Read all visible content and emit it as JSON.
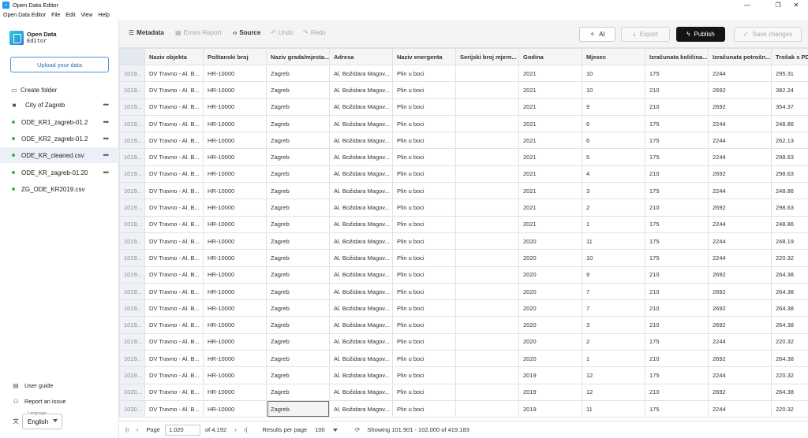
{
  "window": {
    "title": "Open Data Editor",
    "menu": [
      "Open Data Editor",
      "File",
      "Edit",
      "View",
      "Help"
    ]
  },
  "sidebar": {
    "logo_line1": "Open Data",
    "logo_line2": "Editor",
    "upload_label": "Upload your data",
    "create_folder_label": "Create folder",
    "folder_label": "City of Zagreb",
    "files": [
      {
        "label": "ODE_KR1_zagreb-01.2",
        "status_color": "#3bb54a"
      },
      {
        "label": "ODE_KR2_zagreb-01.2",
        "status_color": "#3bb54a"
      },
      {
        "label": "ODE_KR_cleaned.csv",
        "status_color": "#3bb54a"
      },
      {
        "label": "ODE_KR_zagreb-01.20",
        "status_color": "#3bb54a"
      },
      {
        "label": "ZG_ODE_KR2019.csv",
        "status_color": "#3bb54a"
      }
    ],
    "user_guide_label": "User guide",
    "report_issue_label": "Report an issue",
    "language_legend": "Language",
    "language_value": "English"
  },
  "toolbar": {
    "metadata_label": "Metadata",
    "errors_label": "Errors Report",
    "source_label": "Source",
    "undo_label": "Undo",
    "redo_label": "Redo",
    "ai_label": "AI",
    "export_label": "Export",
    "publish_label": "Publish",
    "save_label": "Save changes"
  },
  "grid": {
    "columns": [
      "",
      "Naziv objekta",
      "Poštanski broj",
      "Naziv grada/mjesta...",
      "Adresa",
      "Naziv energenta",
      "Serijski broj mjern...",
      "Godina",
      "Mjesec",
      "Izračunata količina...",
      "Izračunata potrošn...",
      "Trošak s PDV"
    ],
    "rows": [
      [
        "1019...",
        "DV Travno - Al. B...",
        "HR-10000",
        "Zagreb",
        "Al. Božidara Magov...",
        "Plin u boci",
        "",
        "2021",
        "10",
        "175",
        "2244",
        "295.31"
      ],
      [
        "1019...",
        "DV Travno - Al. B...",
        "HR-10000",
        "Zagreb",
        "Al. Božidara Magov...",
        "Plin u boci",
        "",
        "2021",
        "10",
        "210",
        "2692",
        "382.24"
      ],
      [
        "1019...",
        "DV Travno - Al. B...",
        "HR-10000",
        "Zagreb",
        "Al. Božidara Magov...",
        "Plin u boci",
        "",
        "2021",
        "9",
        "210",
        "2692",
        "354.37"
      ],
      [
        "1019...",
        "DV Travno - Al. B...",
        "HR-10000",
        "Zagreb",
        "Al. Božidara Magov...",
        "Plin u boci",
        "",
        "2021",
        "6",
        "175",
        "2244",
        "248.86"
      ],
      [
        "1019...",
        "DV Travno - Al. B...",
        "HR-10000",
        "Zagreb",
        "Al. Božidara Magov...",
        "Plin u boci",
        "",
        "2021",
        "6",
        "175",
        "2244",
        "262.13"
      ],
      [
        "1019...",
        "DV Travno - Al. B...",
        "HR-10000",
        "Zagreb",
        "Al. Božidara Magov...",
        "Plin u boci",
        "",
        "2021",
        "5",
        "175",
        "2244",
        "298.63"
      ],
      [
        "1019...",
        "DV Travno - Al. B...",
        "HR-10000",
        "Zagreb",
        "Al. Božidara Magov...",
        "Plin u boci",
        "",
        "2021",
        "4",
        "210",
        "2692",
        "298.63"
      ],
      [
        "1019...",
        "DV Travno - Al. B...",
        "HR-10000",
        "Zagreb",
        "Al. Božidara Magov...",
        "Plin u boci",
        "",
        "2021",
        "3",
        "175",
        "2244",
        "248.86"
      ],
      [
        "1019...",
        "DV Travno - Al. B...",
        "HR-10000",
        "Zagreb",
        "Al. Božidara Magov...",
        "Plin u boci",
        "",
        "2021",
        "2",
        "210",
        "2692",
        "298.63"
      ],
      [
        "1019...",
        "DV Travno - Al. B...",
        "HR-10000",
        "Zagreb",
        "Al. Božidara Magov...",
        "Plin u boci",
        "",
        "2021",
        "1",
        "175",
        "2244",
        "248.86"
      ],
      [
        "1019...",
        "DV Travno - Al. B...",
        "HR-10000",
        "Zagreb",
        "Al. Božidara Magov...",
        "Plin u boci",
        "",
        "2020",
        "11",
        "175",
        "2244",
        "248.19"
      ],
      [
        "1019...",
        "DV Travno - Al. B...",
        "HR-10000",
        "Zagreb",
        "Al. Božidara Magov...",
        "Plin u boci",
        "",
        "2020",
        "10",
        "175",
        "2244",
        "220.32"
      ],
      [
        "1019...",
        "DV Travno - Al. B...",
        "HR-10000",
        "Zagreb",
        "Al. Božidara Magov...",
        "Plin u boci",
        "",
        "2020",
        "9",
        "210",
        "2692",
        "264.38"
      ],
      [
        "1019...",
        "DV Travno - Al. B...",
        "HR-10000",
        "Zagreb",
        "Al. Božidara Magov...",
        "Plin u boci",
        "",
        "2020",
        "7",
        "210",
        "2692",
        "264.38"
      ],
      [
        "1019...",
        "DV Travno - Al. B...",
        "HR-10000",
        "Zagreb",
        "Al. Božidara Magov...",
        "Plin u boci",
        "",
        "2020",
        "7",
        "210",
        "2692",
        "264.38"
      ],
      [
        "1019...",
        "DV Travno - Al. B...",
        "HR-10000",
        "Zagreb",
        "Al. Božidara Magov...",
        "Plin u boci",
        "",
        "2020",
        "3",
        "210",
        "2692",
        "264.38"
      ],
      [
        "1019...",
        "DV Travno - Al. B...",
        "HR-10000",
        "Zagreb",
        "Al. Božidara Magov...",
        "Plin u boci",
        "",
        "2020",
        "2",
        "175",
        "2244",
        "220.32"
      ],
      [
        "1019...",
        "DV Travno - Al. B...",
        "HR-10000",
        "Zagreb",
        "Al. Božidara Magov...",
        "Plin u boci",
        "",
        "2020",
        "1",
        "210",
        "2692",
        "264.38"
      ],
      [
        "1019...",
        "DV Travno - Al. B...",
        "HR-10000",
        "Zagreb",
        "Al. Božidara Magov...",
        "Plin u boci",
        "",
        "2019",
        "12",
        "175",
        "2244",
        "220.32"
      ],
      [
        "1020...",
        "DV Travno - Al. B...",
        "HR-10000",
        "Zagreb",
        "Al. Božidara Magov...",
        "Plin u boci",
        "",
        "2019",
        "12",
        "210",
        "2692",
        "264.38"
      ],
      [
        "1020...",
        "DV Travno - Al. B...",
        "HR-10000",
        "Zagreb",
        "Al. Božidara Magov...",
        "Plin u boci",
        "",
        "2019",
        "11",
        "175",
        "2244",
        "220.32"
      ]
    ]
  },
  "footer": {
    "page_label": "Page",
    "page_value": "1,020",
    "of_label": "of 4,192",
    "rpp_label": "Results per page",
    "rpp_value": "100",
    "showing_label": "Showing 101,901 - 102,000 of 419,183"
  }
}
